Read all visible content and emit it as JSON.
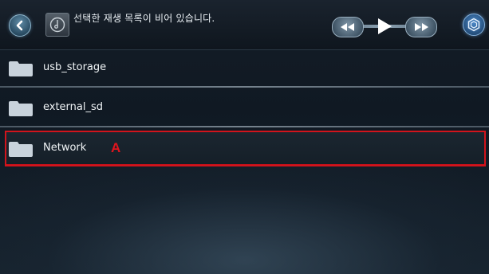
{
  "header": {
    "status_text": "선택한 재생 목록이 비어 있습니다.",
    "back_icon": "back-arrow-icon",
    "disc_icon": "music-disc-icon",
    "settings_icon": "settings-hex-icon"
  },
  "transport": {
    "rewind_icon": "rewind-icon",
    "play_icon": "play-icon",
    "forward_icon": "fast-forward-icon"
  },
  "list": {
    "items": [
      {
        "label": "usb_storage",
        "icon": "folder-icon"
      },
      {
        "label": "external_sd",
        "icon": "folder-icon"
      },
      {
        "label": "Network",
        "icon": "folder-icon"
      }
    ]
  },
  "annotation": {
    "marker_label": "A",
    "color": "#d2141c"
  }
}
